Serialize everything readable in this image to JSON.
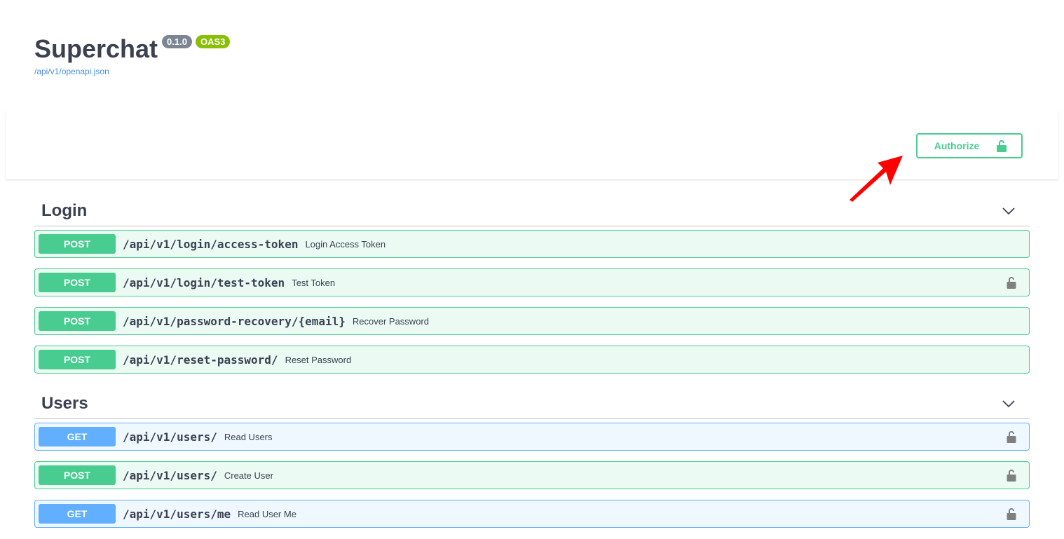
{
  "info": {
    "title": "Superchat",
    "version": "0.1.0",
    "oas": "OAS3",
    "spec_link": "/api/v1/openapi.json"
  },
  "scheme": {
    "authorize_label": "Authorize"
  },
  "colors": {
    "post": "#49cc90",
    "get": "#61affe",
    "text": "#3b4151",
    "link": "#4990e2",
    "annotation_arrow": "#ff0000"
  },
  "icons": {
    "authorize": "unlocked-icon",
    "operation_lock": "unlocked-icon",
    "section_toggle": "chevron-down-icon"
  },
  "tags": [
    {
      "name": "Login",
      "operations": [
        {
          "method": "POST",
          "path": "/api/v1/login/access-token",
          "summary": "Login Access Token",
          "locked": false
        },
        {
          "method": "POST",
          "path": "/api/v1/login/test-token",
          "summary": "Test Token",
          "locked": true
        },
        {
          "method": "POST",
          "path": "/api/v1/password-recovery/{email}",
          "summary": "Recover Password",
          "locked": false
        },
        {
          "method": "POST",
          "path": "/api/v1/reset-password/",
          "summary": "Reset Password",
          "locked": false
        }
      ]
    },
    {
      "name": "Users",
      "operations": [
        {
          "method": "GET",
          "path": "/api/v1/users/",
          "summary": "Read Users",
          "locked": true
        },
        {
          "method": "POST",
          "path": "/api/v1/users/",
          "summary": "Create User",
          "locked": true
        },
        {
          "method": "GET",
          "path": "/api/v1/users/me",
          "summary": "Read User Me",
          "locked": true
        }
      ]
    }
  ]
}
